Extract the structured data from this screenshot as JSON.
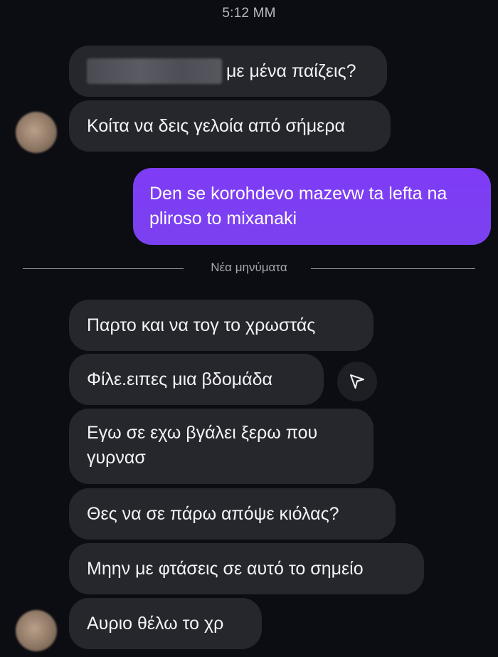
{
  "status_time": "5:12 MM",
  "divider_label": "Νέα μηνύματα",
  "messages": [
    {
      "text": "με μένα παίζεις?",
      "sender": "other",
      "redacted_prefix": true
    },
    {
      "text": "Κοίτα να δεις γελοία από σήμερα",
      "sender": "other"
    },
    {
      "text": "Den se korohdevo mazevw ta lefta na pliroso to mixanaki",
      "sender": "me"
    },
    {
      "text": "Παρτο και να τογ το χρωστάς",
      "sender": "other"
    },
    {
      "text": "Φίλε.ειπες μια βδομάδα",
      "sender": "other"
    },
    {
      "text": "Εγω σε εχω βγάλει ξερω που γυρνασ",
      "sender": "other"
    },
    {
      "text": "Θες να σε πάρω απόψε κιόλας?",
      "sender": "other"
    },
    {
      "text": "Μηην με φτάσεις σε αυτό το σημείο",
      "sender": "other"
    },
    {
      "text": "Αυριο θέλω το χρ",
      "sender": "other"
    }
  ],
  "icons": {
    "share": "send-icon",
    "avatar": "contact-avatar"
  },
  "colors": {
    "background": "#0c0d12",
    "received_bubble": "#26272d",
    "sent_bubble": "#7b3ff2"
  }
}
